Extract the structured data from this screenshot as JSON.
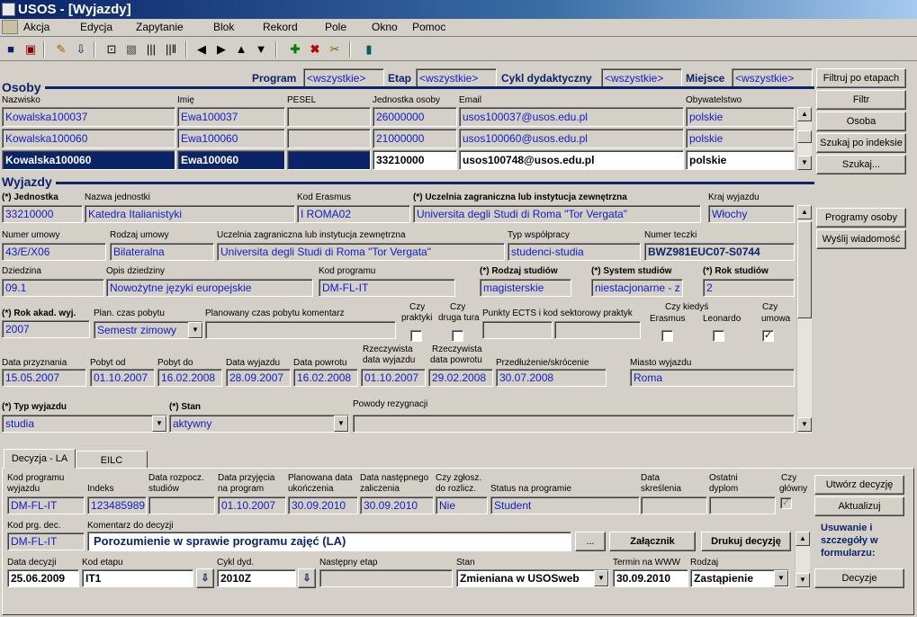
{
  "window": {
    "title": "USOS - [Wyjazdy]"
  },
  "menu": [
    "Akcja",
    "Edycja",
    "Zapytanie",
    "Blok",
    "Rekord",
    "Pole",
    "Okno",
    "Pomoc"
  ],
  "filter": {
    "program_label": "Program",
    "program_value": "<wszystkie>",
    "etap_label": "Etap",
    "etap_value": "<wszystkie>",
    "cykl_label": "Cykl dydaktyczny",
    "cykl_value": "<wszystkie>",
    "miejsce_label": "Miejsce",
    "miejsce_value": "<wszystkie>"
  },
  "osoby": {
    "title": "Osoby",
    "headers": [
      "Nazwisko",
      "Imię",
      "PESEL",
      "Jednostka osoby",
      "Email",
      "Obywatelstwo"
    ],
    "rows": [
      {
        "nazwisko": "Kowalska100037",
        "imie": "Ewa100037",
        "pesel": "",
        "jednostka": "26000000",
        "email": "usos100037@usos.edu.pl",
        "obyw": "polskie"
      },
      {
        "nazwisko": "Kowalska100060",
        "imie": "Ewa100060",
        "pesel": "",
        "jednostka": "21000000",
        "email": "usos100060@usos.edu.pl",
        "obyw": "polskie"
      },
      {
        "nazwisko": "Kowalska100060",
        "imie": "Ewa100060",
        "pesel": "",
        "jednostka": "33210000",
        "email": "usos100748@usos.edu.pl",
        "obyw": "polskie"
      }
    ]
  },
  "right_buttons": {
    "filtruj": "Filtruj po etapach",
    "filtr": "Filtr",
    "osoba": "Osoba",
    "szukaj_idx": "Szukaj po indeksie",
    "szukaj": "Szukaj...",
    "programy": "Programy osoby",
    "wyslij": "Wyślij wiadomość"
  },
  "wyjazdy": {
    "title": "Wyjazdy",
    "l_jednostka": "(*) Jednostka",
    "v_jednostka": "33210000",
    "l_nazwa_jedn": "Nazwa jednostki",
    "v_nazwa_jedn": "Katedra Italianistyki",
    "l_kod_erasmus": "Kod Erasmus",
    "v_kod_erasmus": "I  ROMA02",
    "l_uczelnia": "(*) Uczelnia zagraniczna lub instytucja zewnętrzna",
    "v_uczelnia": "Universita degli Studi di Roma \"Tor Vergata\"",
    "l_kraj": "Kraj wyjazdu",
    "v_kraj": "Włochy",
    "l_nr_umowy": "Numer umowy",
    "v_nr_umowy": "43/E/X06",
    "l_rodzaj_umowy": "Rodzaj umowy",
    "v_rodzaj_umowy": "Bilateralna",
    "l_uczelnia2": "Uczelnia zagraniczna lub instytucja zewnętrzna",
    "v_uczelnia2": "Universita degli Studi di Roma \"Tor Vergata\"",
    "l_typ_wsp": "Typ współpracy",
    "v_typ_wsp": "studenci-studia",
    "l_nr_teczki": "Numer teczki",
    "v_nr_teczki": "BWZ981EUC07-S0744",
    "l_dziedzina": "Dziedzina",
    "v_dziedzina": "09.1",
    "l_opis_dz": "Opis dziedziny",
    "v_opis_dz": "Nowożytne języki europejskie",
    "l_kod_prog": "Kod programu",
    "v_kod_prog": "DM-FL-IT",
    "l_rodzaj_st": "(*) Rodzaj studiów",
    "v_rodzaj_st": "magisterskie",
    "l_system_st": "(*) System studiów",
    "v_system_st": "niestacjonarne - z",
    "l_rok_st": "(*) Rok studiów",
    "v_rok_st": "2",
    "l_rok_akad": "(*) Rok akad. wyj.",
    "v_rok_akad": "2007",
    "l_plan_czas": "Plan. czas pobytu",
    "v_plan_czas": "Semestr zimowy",
    "l_plan_kom": "Planowany czas pobytu komentarz",
    "v_plan_kom": "",
    "l_czy_prakt1": "Czy",
    "l_czy_prakt2": "praktyki",
    "l_czy_druga1": "Czy",
    "l_czy_druga2": "druga tura",
    "l_ects": "Punkty ECTS i kod sektorowy praktyk",
    "l_czy_kiedys": "Czy kiedyś",
    "l_erasmus": "Erasmus",
    "l_leonardo": "Leonardo",
    "l_czy_um1": "Czy",
    "l_czy_um2": "umowa",
    "umowa_check": "✓",
    "l_data_przyzn": "Data przyznania",
    "v_data_przyzn": "15.05.2007",
    "l_pobyt_od": "Pobyt od",
    "v_pobyt_od": "01.10.2007",
    "l_pobyt_do": "Pobyt do",
    "v_pobyt_do": "16.02.2008",
    "l_data_wyj": "Data wyjazdu",
    "v_data_wyj": "28.09.2007",
    "l_data_pow": "Data powrotu",
    "v_data_pow": "16.02.2008",
    "l_rz_wyj1": "Rzeczywista",
    "l_rz_wyj2": "data wyjazdu",
    "v_rz_wyj": "01.10.2007",
    "l_rz_pow1": "Rzeczywista",
    "l_rz_pow2": "data powrotu",
    "v_rz_pow": "29.02.2008",
    "l_przedl": "Przedłużenie/skrócenie",
    "v_przedl": "30.07.2008",
    "l_miasto": "Miasto wyjazdu",
    "v_miasto": "Roma",
    "l_typ_wyj": "(*) Typ wyjazdu",
    "v_typ_wyj": "studia",
    "l_stan": "(*) Stan",
    "v_stan": "aktywny",
    "l_powody": "Powody rezygnacji",
    "v_powody": ""
  },
  "tabs": [
    "Decyzja - LA",
    "EILC"
  ],
  "decyzja": {
    "l_kod_prog1": "Kod programu",
    "l_kod_prog2": "wyjazdu",
    "v_kod_prog": "DM-FL-IT",
    "l_indeks": "Indeks",
    "v_indeks": "123485989",
    "l_data_rozp1": "Data rozpocz.",
    "l_data_rozp2": "studiów",
    "v_data_rozp": "",
    "l_data_przyj1": "Data przyjęcia",
    "l_data_przyj2": "na program",
    "v_data_przyj": "01.10.2007",
    "l_plan_data1": "Planowana data",
    "l_plan_data2": "ukończenia",
    "v_plan_data": "30.09.2010",
    "l_data_nast1": "Data następnego",
    "l_data_nast2": "zaliczenia",
    "v_data_nast": "30.09.2010",
    "l_czy_zgl1": "Czy zgłosz.",
    "l_czy_zgl2": "do rozlicz.",
    "v_czy_zgl": "Nie",
    "l_status": "Status na programie",
    "v_status": "Student",
    "l_data_skr1": "Data",
    "l_data_skr2": "skreślenia",
    "v_data_skr": "",
    "l_ost_dypl1": "Ostatni",
    "l_ost_dypl2": "dyplom",
    "v_ost_dypl": "",
    "l_czy_glowny1": "Czy",
    "l_czy_glowny2": "główny",
    "glowny_check": "✓",
    "l_kod_prg_dec": "Kod prg. dec.",
    "v_kod_prg_dec": "DM-FL-IT",
    "l_komentarz": "Komentarz  do decyzji",
    "v_komentarz": "Porozumienie w sprawie programu zajęć (LA)",
    "ellipsis": "...",
    "zalacznik": "Załącznik",
    "drukuj": "Drukuj decyzję",
    "l_data_dec": "Data decyzji",
    "v_data_dec": "25.06.2009",
    "l_kod_etapu": "Kod etapu",
    "v_kod_etapu": "IT1",
    "l_cykl": "Cykl dyd.",
    "v_cykl": "2010Z",
    "l_nast_etap": "Następny etap",
    "v_nast_etap": "",
    "l_stan": "Stan",
    "v_stan": "Zmieniana w USOSweb",
    "l_termin": "Termin na WWW",
    "v_termin": "30.09.2010",
    "l_rodzaj": "Rodzaj",
    "v_rodzaj": "Zastąpienie",
    "utworz": "Utwórz decyzję",
    "aktualizuj": "Aktualizuj",
    "info": "Usuwanie i szczegóły w formularzu:",
    "decyzje": "Decyzje"
  }
}
